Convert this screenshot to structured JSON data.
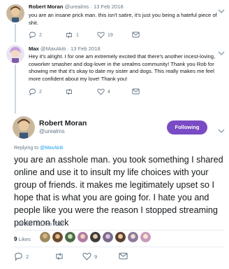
{
  "tweet1": {
    "name": "Robert Moran",
    "handle_date": "@urealms · 13 Feb 2018",
    "text": "you are an insane prick man. this isn't satire, it's just you being a hateful piece of shit.",
    "replies": "2",
    "retweets": "1",
    "likes": "19"
  },
  "tweet2": {
    "name": "Max",
    "handle_date": "@MaxAkiti · 13 Feb 2018",
    "text": "Hey it's alright. I for one am extremely excited that there's another incest-loving, coworker smasher and dog-lover in the urealms community! Thank you Rob for showing me that it's okay to date my sister and dogs. This really makes me feel more confident about my love! Thank you!",
    "replies": "2",
    "retweets": "",
    "likes": "4"
  },
  "main": {
    "name": "Robert Moran",
    "handle": "@urealms",
    "follow_label": "Following",
    "replying_prefix": "Replying to ",
    "replying_to": "@MaxAkiti",
    "text": "you are an asshole man. you took something I shared online and use it to insult my life choices with your group of friends. it makes me legitimately upset so I hope that is what you are going for. I hate you and people like you were the reason I stopped streaming pokemon fuck",
    "timestamp": "1:18 PM - 13 Feb 2018",
    "likes_count": "9",
    "likes_label": "Likes",
    "replies": "2",
    "retweets": "",
    "likes": "9"
  },
  "colors": {
    "accent": "#794bc4",
    "link": "#1da1f2",
    "muted": "#657786"
  },
  "icons": [
    "reply-icon",
    "retweet-icon",
    "heart-icon",
    "envelope-icon",
    "chevron-down-icon"
  ]
}
